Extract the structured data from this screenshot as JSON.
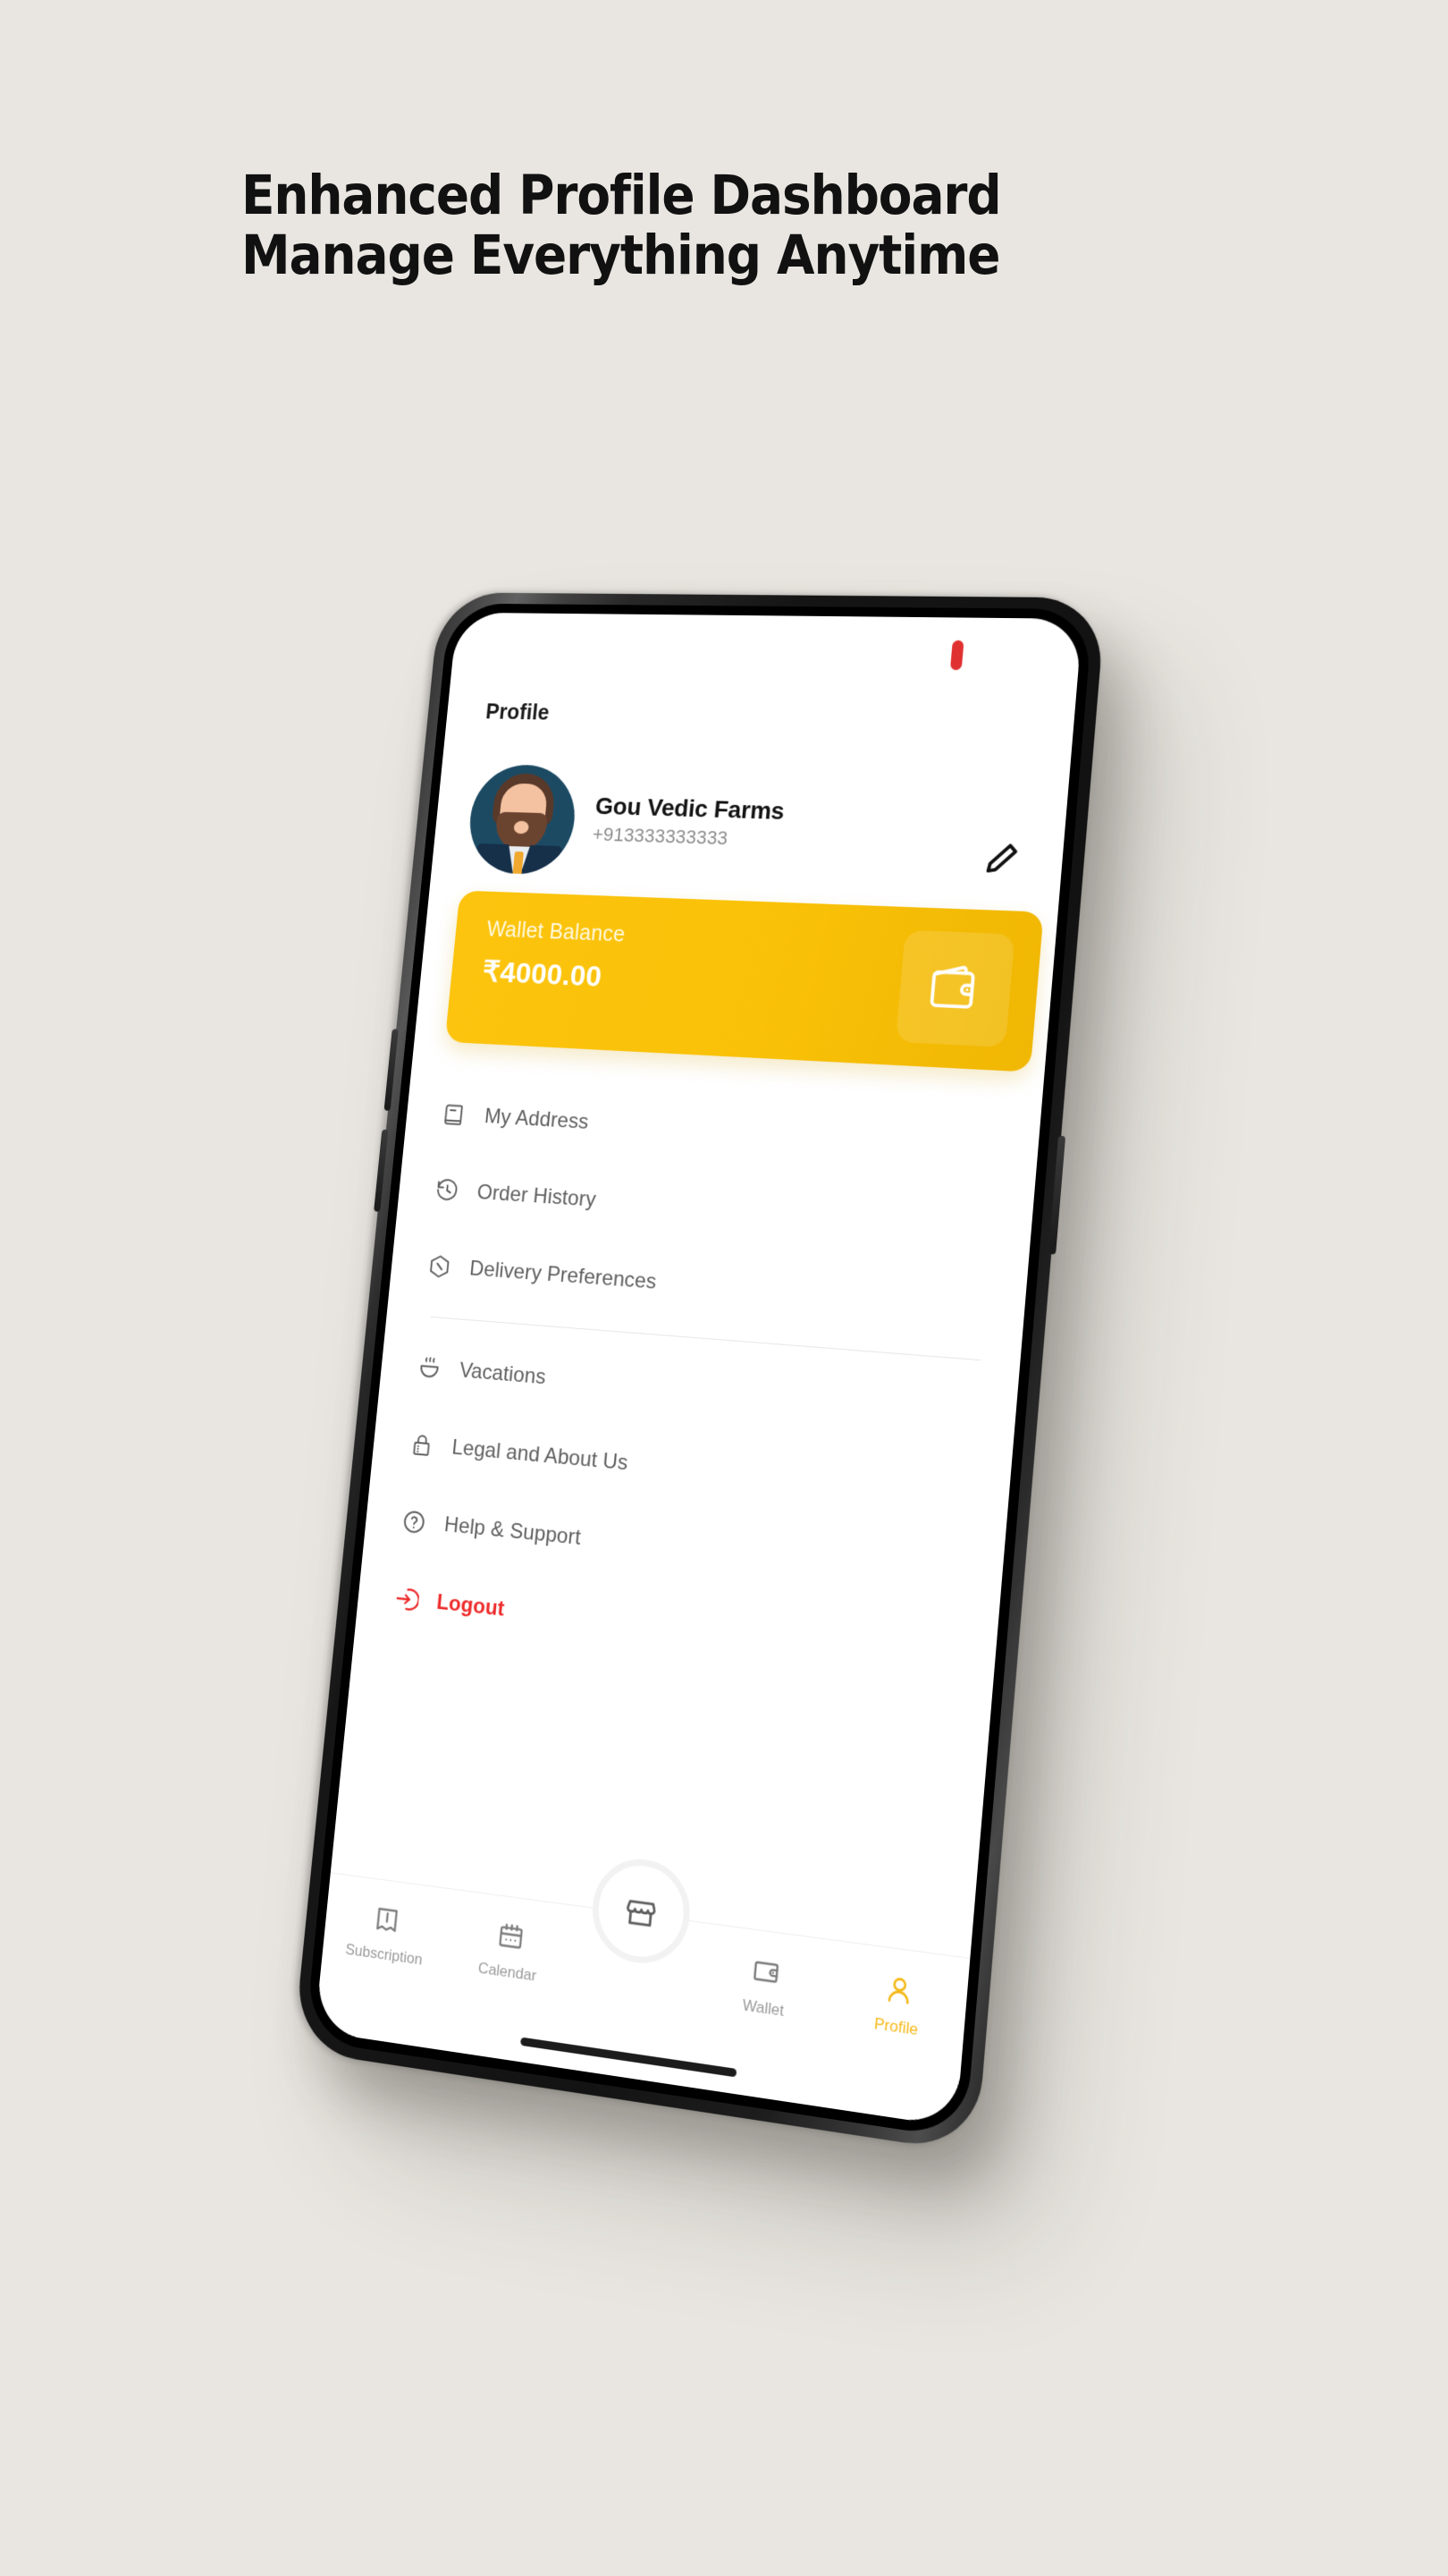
{
  "headline": {
    "line1": "Enhanced Profile Dashboard",
    "line2": "Manage Everything Anytime"
  },
  "colors": {
    "page_background": "#E9E6E1",
    "accent_yellow": "#F9C107",
    "logout_red": "#EE2B2B",
    "notch_indicator_red": "#E03131",
    "text_dark": "#141414",
    "text_muted": "#5e5e5e"
  },
  "screen": {
    "title": "Profile",
    "profile": {
      "name": "Gou Vedic Farms",
      "phone": "+913333333333",
      "avatar_icon": "user-avatar-illustration",
      "edit_icon": "pencil-icon"
    },
    "wallet": {
      "label": "Wallet Balance",
      "amount": "₹4000.00",
      "icon": "wallet-icon"
    },
    "menu_group_1": [
      {
        "label": "My Address",
        "icon": "address-book-icon"
      },
      {
        "label": "Order History",
        "icon": "history-clock-icon"
      },
      {
        "label": "Delivery Preferences",
        "icon": "hexagon-slash-icon"
      }
    ],
    "menu_group_2": [
      {
        "label": "Vacations",
        "icon": "hot-bowl-icon"
      },
      {
        "label": "Legal and About Us",
        "icon": "lock-icon"
      },
      {
        "label": "Help & Support",
        "icon": "question-circle-icon"
      },
      {
        "label": "Logout",
        "icon": "logout-arrow-icon"
      }
    ],
    "bottom_nav": {
      "fab_icon": "store-icon",
      "items": [
        {
          "label": "Subscription",
          "icon": "ticket-icon",
          "active": false
        },
        {
          "label": "Calendar",
          "icon": "calendar-icon",
          "active": false
        },
        {
          "label": "Wallet",
          "icon": "wallet-outline-icon",
          "active": false
        },
        {
          "label": "Profile",
          "icon": "person-icon",
          "active": true
        }
      ]
    }
  }
}
